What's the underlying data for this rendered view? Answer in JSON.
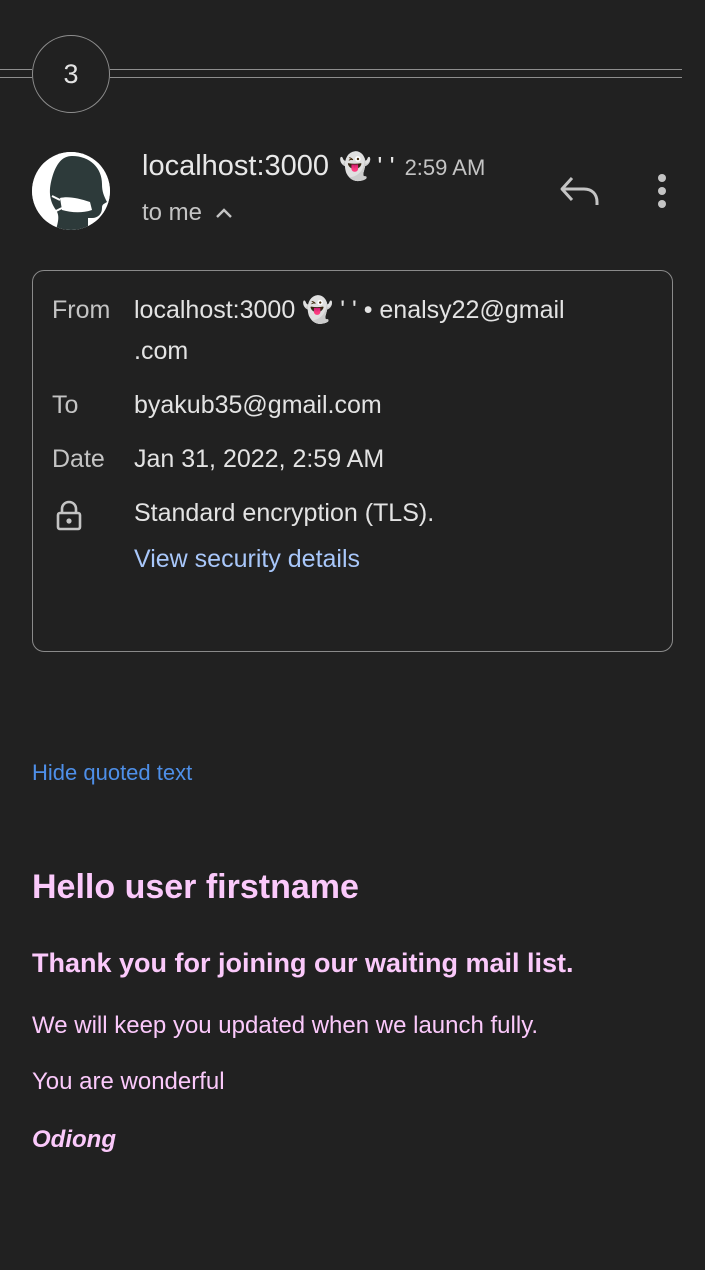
{
  "thread": {
    "message_count": "3"
  },
  "sender": {
    "name": "localhost:3000",
    "emoji": "👻",
    "quotes": "' '",
    "time": "2:59 AM",
    "recipient_summary": "to me"
  },
  "details": {
    "from_label": "From",
    "from_value_line1": "localhost:3000 👻 ' ' • enalsy22@gmail",
    "from_value_line2": ".com",
    "to_label": "To",
    "to_value": "byakub35@gmail.com",
    "date_label": "Date",
    "date_value": "Jan 31, 2022, 2:59 AM",
    "encryption_text": "Standard encryption (TLS).",
    "security_link": "View security details"
  },
  "hide_quoted_label": "Hide quoted text",
  "message": {
    "heading": "Hello user firstname",
    "subheading": "Thank you for joining our waiting mail list.",
    "paragraph1": "We will keep you updated when we launch fully.",
    "paragraph2": "You are wonderful",
    "signature": "Odiong"
  },
  "icons": {
    "avatar": "masked-person-icon",
    "expand": "chevron-up-icon",
    "reply": "reply-icon",
    "more": "more-vert-icon",
    "lock": "lock-icon"
  },
  "colors": {
    "background": "#212121",
    "link": "#a8c7fa",
    "hide_quoted": "#4e8fe8",
    "message_text": "#fbc9fb"
  }
}
